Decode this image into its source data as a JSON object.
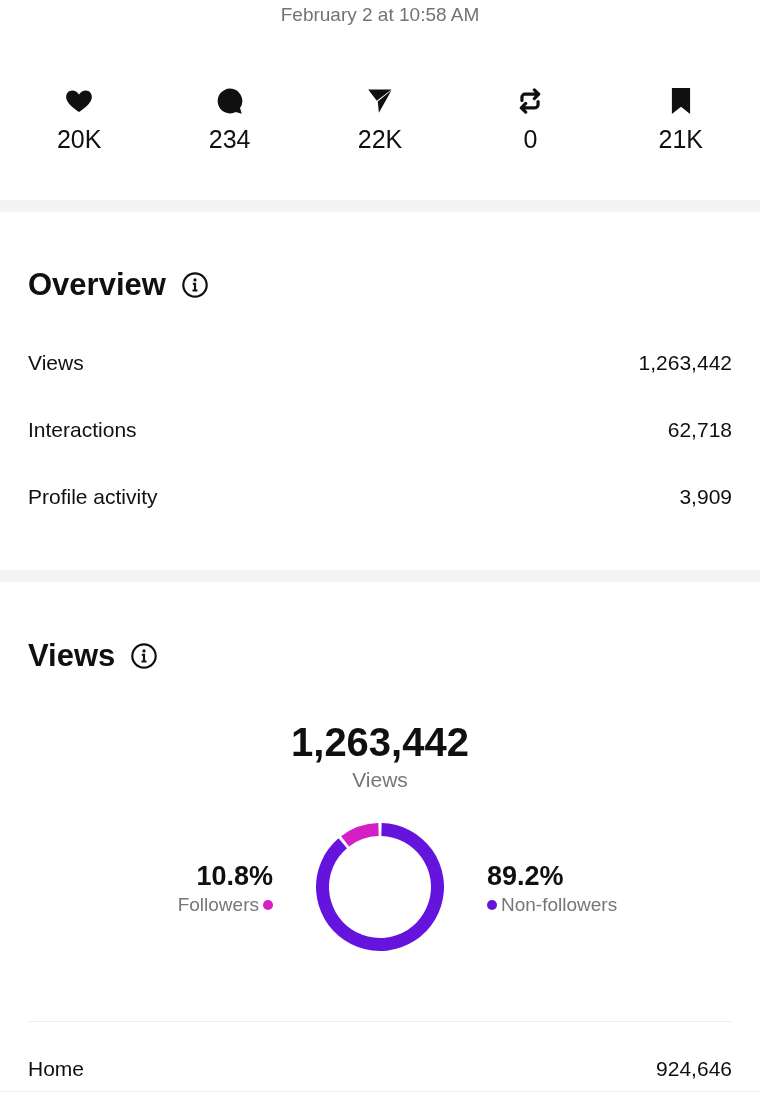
{
  "timestamp": "February 2 at 10:58 AM",
  "stats": [
    {
      "kind": "like",
      "count": "20K"
    },
    {
      "kind": "comment",
      "count": "234"
    },
    {
      "kind": "share",
      "count": "22K"
    },
    {
      "kind": "repost",
      "count": "0"
    },
    {
      "kind": "save",
      "count": "21K"
    }
  ],
  "overview": {
    "title": "Overview",
    "rows": [
      {
        "label": "Views",
        "value": "1,263,442"
      },
      {
        "label": "Interactions",
        "value": "62,718"
      },
      {
        "label": "Profile activity",
        "value": "3,909"
      }
    ]
  },
  "views": {
    "title": "Views",
    "total": "1,263,442",
    "total_label": "Views",
    "legend": [
      {
        "percent": "10.8%",
        "color": "#d41fc4"
      },
      {
        "percent": "89.2%",
        "color": "#6414dc"
      }
    ],
    "chart_data": {
      "type": "donut",
      "categories": [
        "Followers",
        "Non-followers"
      ],
      "values": [
        10.8,
        89.2
      ]
    },
    "sources": [
      {
        "label": "Home",
        "value": "924,646"
      }
    ]
  }
}
